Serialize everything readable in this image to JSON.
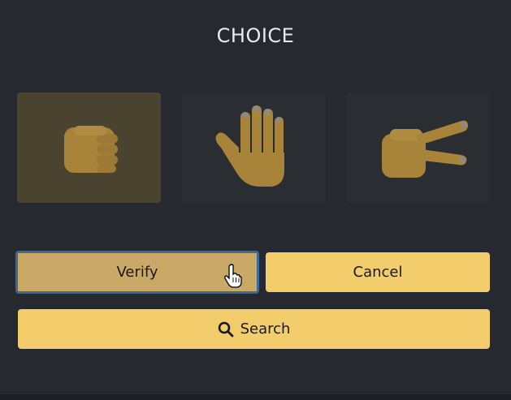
{
  "title": "CHOICE",
  "choices": [
    {
      "icon": "fist-icon",
      "selected": true
    },
    {
      "icon": "open-hand-icon",
      "selected": false
    },
    {
      "icon": "two-fingers-icon",
      "selected": false
    }
  ],
  "buttons": {
    "verify_label": "Verify",
    "cancel_label": "Cancel",
    "search_label": "Search"
  },
  "colors": {
    "background": "#262a30",
    "accent": "#f3cc6b",
    "selected_button": "#c9a965",
    "focus_ring": "#3a6b96"
  }
}
